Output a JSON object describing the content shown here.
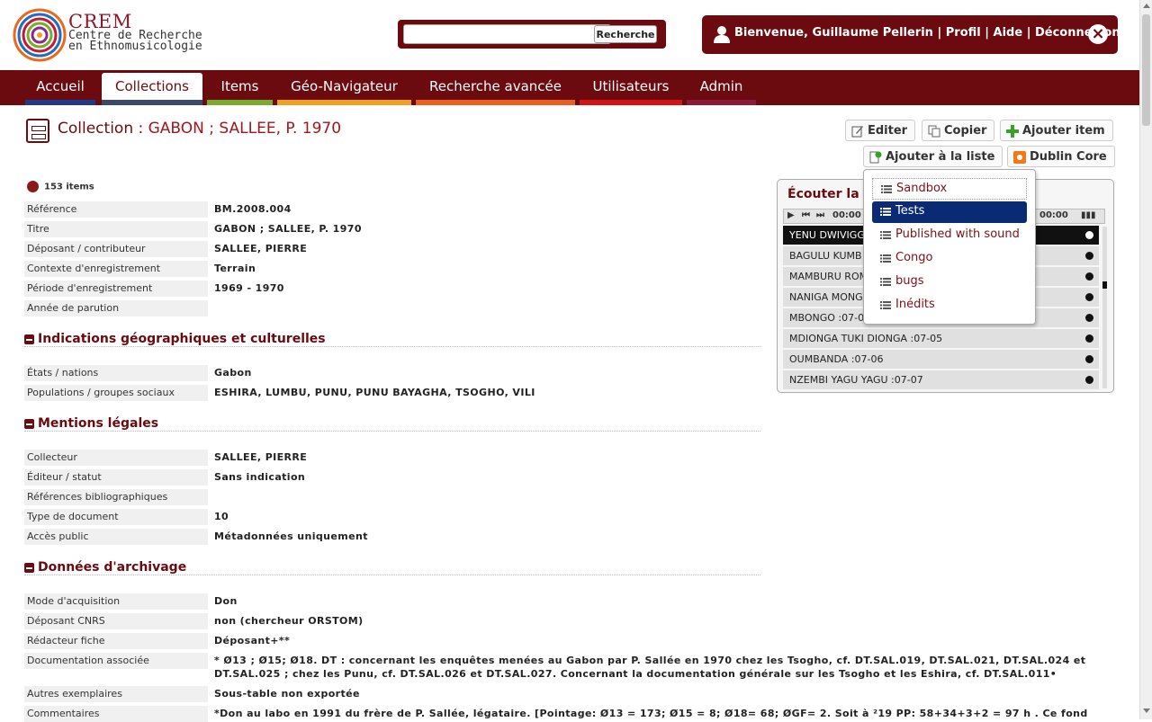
{
  "header": {
    "logo_text": "CREM",
    "logo_line1": "Centre de Recherche",
    "logo_line2": "en Ethnomusicologie",
    "search_placeholder": "",
    "search_button": "Recherche",
    "welcome": "Bienvenue, Guillaume Pellerin",
    "profile_link": "Profil",
    "help_link": "Aide",
    "logout_link": "Déconnexion",
    "separator": " | "
  },
  "nav": {
    "tabs": [
      {
        "label": "Accueil",
        "color": "#1f3a8a"
      },
      {
        "label": "Collections",
        "color": "#3b4a6b"
      },
      {
        "label": "Items",
        "color": "#7bab2a"
      },
      {
        "label": "Géo-Navigateur",
        "color": "#f0a020"
      },
      {
        "label": "Recherche avancée",
        "color": "#e8601c"
      },
      {
        "label": "Utilisateurs",
        "color": "#d41414"
      },
      {
        "label": "Admin",
        "color": "#8a1a3a"
      }
    ],
    "active": "Collections"
  },
  "title": {
    "prefix": "Collection : ",
    "name": "GABON ; SALLEE, P. 1970"
  },
  "actions": {
    "edit": "Editer",
    "copy": "Copier",
    "add_item": "Ajouter item",
    "add_to_list": "Ajouter à la liste",
    "dublin_core": "Dublin Core"
  },
  "items_count": "153 items",
  "metadata": [
    {
      "label": "Référence",
      "value": "BM.2008.004"
    },
    {
      "label": "Titre",
      "value": "GABON ; SALLEE, P. 1970"
    },
    {
      "label": "Déposant / contributeur",
      "value": "SALLEE, PIERRE"
    },
    {
      "label": "Contexte d'enregistrement",
      "value": "Terrain"
    },
    {
      "label": "Période d'enregistrement",
      "value": "1969 - 1970"
    },
    {
      "label": "Année de parution",
      "value": ""
    }
  ],
  "sections": {
    "geo": {
      "title": "Indications géographiques et culturelles",
      "rows": [
        {
          "label": "États / nations",
          "value": "Gabon"
        },
        {
          "label": "Populations / groupes sociaux",
          "value": "ESHIRA, LUMBU, PUNU, PUNU BAYAGHA, TSOGHO, VILI"
        }
      ]
    },
    "legal": {
      "title": "Mentions légales",
      "rows": [
        {
          "label": "Collecteur",
          "value": "SALLEE, PIERRE"
        },
        {
          "label": "Éditeur / statut",
          "value": "Sans indication"
        },
        {
          "label": "Références bibliographiques",
          "value": ""
        },
        {
          "label": "Type de document",
          "value": "10"
        },
        {
          "label": "Accès public",
          "value": "Métadonnées uniquement"
        }
      ]
    },
    "archive": {
      "title": "Données d'archivage",
      "rows": [
        {
          "label": "Mode d'acquisition",
          "value": "Don"
        },
        {
          "label": "Déposant CNRS",
          "value": "non (chercheur ORSTOM)"
        },
        {
          "label": "Rédacteur fiche",
          "value": "Déposant+**"
        },
        {
          "label": "Documentation associée",
          "value": "* Ø13 ; Ø15; Ø18. DT : concernant les enquêtes menées au Gabon par P. Sallée en 1970 chez les Tsogho, cf. DT.SAL.019, DT.SAL.021, DT.SAL.024 et DT.SAL.025 ; chez les Punu, cf. DT.SAL.026 et DT.SAL.027. Concernant la documentation générale sur les Tsogho et les Eshira, cf. DT.SAL.011•"
        },
        {
          "label": "Autres exemplaires",
          "value": "Sous-table non exportée"
        },
        {
          "label": "Commentaires",
          "value": "*Don au labo en 1991 du frère de P. Sallée, légataire. [Pointage: Ø13 = 173; Ø15 = 8; Ø18= 68; ØGF= 2. Soit à ²19 PP: 58+34+3+2 = 97 h . Ce fonds P."
        }
      ]
    }
  },
  "player": {
    "title": "Écouter la c",
    "time_start": "00:00",
    "time_end": "00:00",
    "tracks": [
      "YENU DWIVIGG",
      "BAGULU KUMB",
      "MAMBURU ROM",
      "NANIGA MONGA",
      "MBONGO :07-0",
      "MDIONGA TUKI DIONGA :07-05",
      "OUMBANDA :07-06",
      "NZEMBI YAGU YAGU :07-07"
    ]
  },
  "dropdown": {
    "items": [
      "Sandbox",
      "Tests",
      "Published with sound",
      "Congo",
      "bugs",
      "Inédits"
    ],
    "selected": "Tests"
  }
}
